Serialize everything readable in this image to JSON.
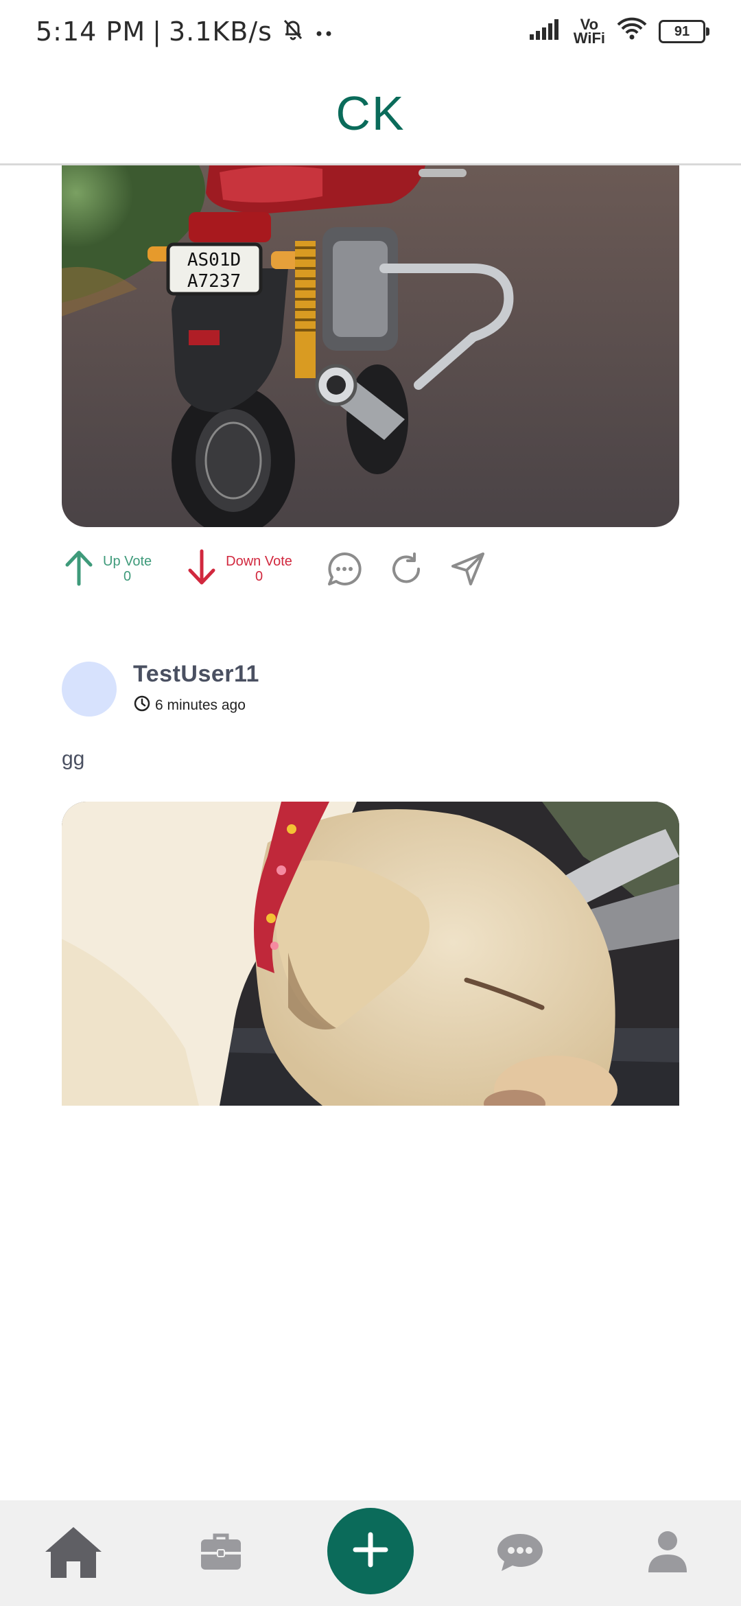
{
  "status_bar": {
    "time": "5:14 PM",
    "speed": "3.1KB/s",
    "vowifi_top": "Vo",
    "vowifi_bottom": "WiFi",
    "battery": "91"
  },
  "header": {
    "title": "CK"
  },
  "post1": {
    "image": "motorcycle-photo",
    "plate_line1": "AS01D",
    "plate_line2": "A7237",
    "actions": {
      "upvote_label": "Up Vote",
      "upvote_count": "0",
      "downvote_label": "Down Vote",
      "downvote_count": "0"
    }
  },
  "post2": {
    "username": "TestUser11",
    "time_ago": "6 minutes ago",
    "text": "gg",
    "image": "sleeping-puppy-photo"
  },
  "colors": {
    "accent": "#0a6b5a",
    "upvote": "#3e9a7a",
    "downvote": "#d1283e",
    "avatar": "#d7e2fd"
  },
  "bottom_nav": [
    "home-icon",
    "briefcase-icon",
    "add-icon",
    "chat-icon",
    "profile-icon"
  ]
}
